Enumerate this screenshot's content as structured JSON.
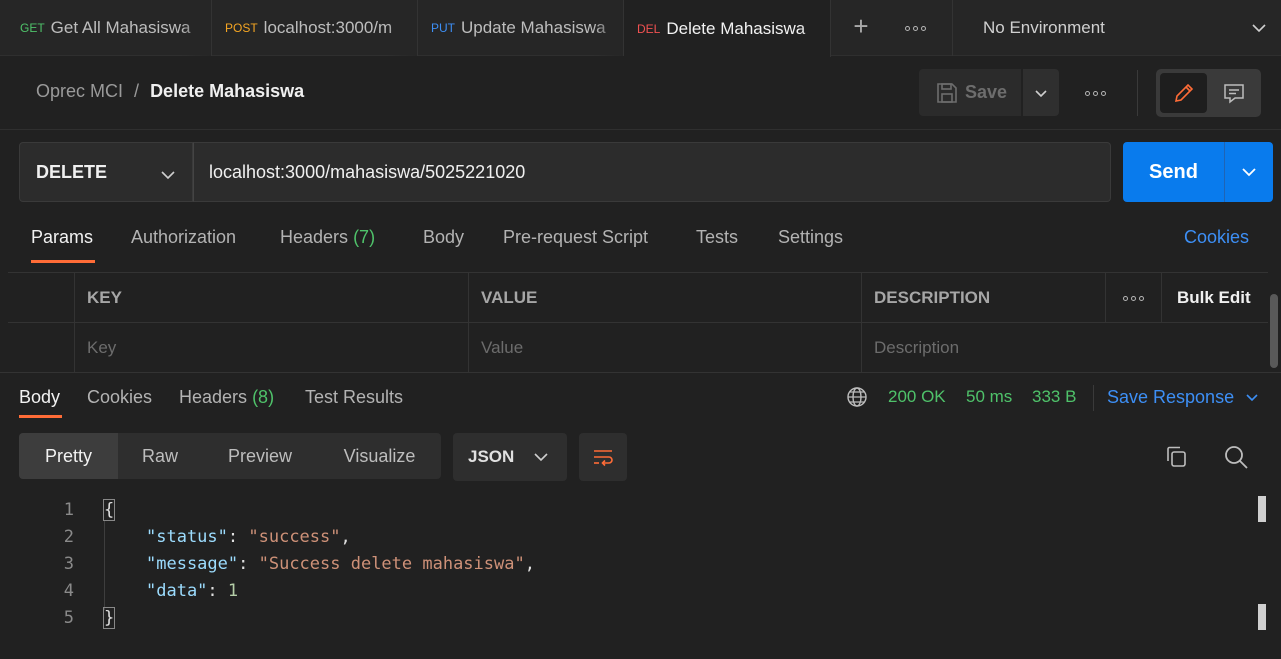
{
  "tabs": [
    {
      "method": "GET",
      "method_color": "#4fc26a",
      "title": "Get All Mahasiswa"
    },
    {
      "method": "POST",
      "method_color": "#f5a623",
      "title": "localhost:3000/m"
    },
    {
      "method": "PUT",
      "method_color": "#3d8ff5",
      "title": "Update Mahasiswa"
    },
    {
      "method": "DEL",
      "method_color": "#f05151",
      "title": "Delete Mahasiswa"
    }
  ],
  "environment": "No Environment",
  "breadcrumb": {
    "collection": "Oprec MCI",
    "separator": "/",
    "request": "Delete Mahasiswa"
  },
  "toolbar": {
    "save_label": "Save"
  },
  "request": {
    "method": "DELETE",
    "url": "localhost:3000/mahasiswa/5025221020",
    "send_label": "Send"
  },
  "request_tabs": {
    "params": "Params",
    "authorization": "Authorization",
    "headers": "Headers",
    "headers_count": "(7)",
    "body": "Body",
    "prerequest": "Pre-request Script",
    "tests": "Tests",
    "settings": "Settings",
    "cookies": "Cookies"
  },
  "params_table": {
    "headers": {
      "key": "KEY",
      "value": "VALUE",
      "description": "DESCRIPTION",
      "bulk_edit": "Bulk Edit"
    },
    "placeholders": {
      "key": "Key",
      "value": "Value",
      "description": "Description"
    }
  },
  "response_tabs": {
    "body": "Body",
    "cookies": "Cookies",
    "headers": "Headers",
    "headers_count": "(8)",
    "test_results": "Test Results"
  },
  "response_meta": {
    "status": "200 OK",
    "time": "50 ms",
    "size": "333 B",
    "save_response": "Save Response"
  },
  "view": {
    "pretty": "Pretty",
    "raw": "Raw",
    "preview": "Preview",
    "visualize": "Visualize",
    "format": "JSON"
  },
  "code": {
    "line_numbers": [
      "1",
      "2",
      "3",
      "4",
      "5"
    ],
    "open_brace": "{",
    "close_brace": "}",
    "status_key": "\"status\"",
    "status_value": "\"success\"",
    "message_key": "\"message\"",
    "message_value": "\"Success delete mahasiswa\"",
    "data_key": "\"data\"",
    "data_value": "1",
    "colon": ": ",
    "comma": ","
  },
  "colors": {
    "accent": "#ff6c37",
    "send": "#097bed",
    "link": "#3d8ff5",
    "success": "#4fc26a"
  }
}
